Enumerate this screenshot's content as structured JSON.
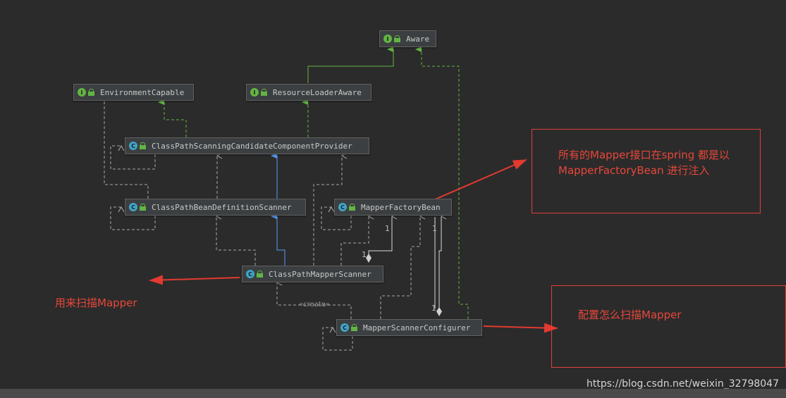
{
  "nodes": {
    "aware": {
      "label": "Aware",
      "kind": "interface",
      "badge": "I"
    },
    "environment_capable": {
      "label": "EnvironmentCapable",
      "kind": "interface",
      "badge": "I"
    },
    "resource_loader_aware": {
      "label": "ResourceLoaderAware",
      "kind": "interface",
      "badge": "I"
    },
    "candidate_provider": {
      "label": "ClassPathScanningCandidateComponentProvider",
      "kind": "class",
      "badge": "C"
    },
    "bean_definition_scanner": {
      "label": "ClassPathBeanDefinitionScanner",
      "kind": "class",
      "badge": "C"
    },
    "mapper_factory_bean": {
      "label": "MapperFactoryBean",
      "kind": "class",
      "badge": "C"
    },
    "mapper_scanner": {
      "label": "ClassPathMapperScanner",
      "kind": "class",
      "badge": "C"
    },
    "scanner_configurer": {
      "label": "MapperScannerConfigurer",
      "kind": "class",
      "badge": "C"
    }
  },
  "labels": {
    "creates": "«create»",
    "mult_a": "1",
    "mult_b": "1",
    "mult_c": "1",
    "mult_d": "1"
  },
  "annotations": {
    "factory_bean_note_line1": "所有的Mapper接口在spring 都是以",
    "factory_bean_note_line2": "MapperFactoryBean 进行注入",
    "scan_mapper_note": "用来扫描Mapper",
    "configure_scan_note": "配置怎么扫描Mapper"
  },
  "watermark": "https://blog.csdn.net/weixin_32798047",
  "colors": {
    "background": "#2b2b2b",
    "node_fill": "#3c3f41",
    "interface_badge": "#62b543",
    "class_badge": "#40a5c8",
    "implements_arrow": "#62b543",
    "extends_arrow": "#589df6",
    "dependency_arrow": "#aaaaaa",
    "annotation_red": "#e9473a"
  }
}
